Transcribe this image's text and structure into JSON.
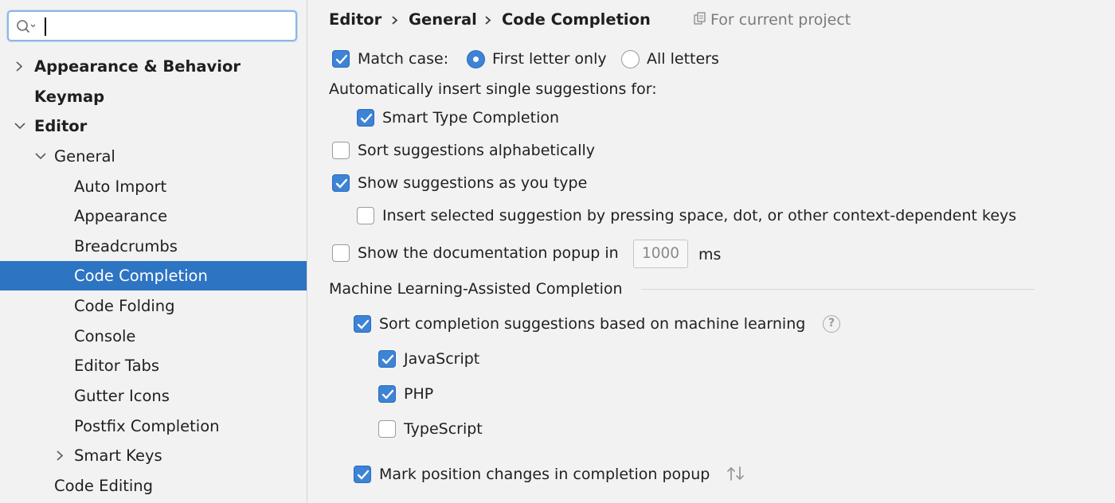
{
  "search": {
    "placeholder": "",
    "value": ""
  },
  "sidebar": {
    "items": [
      {
        "label": "Appearance & Behavior",
        "arrow": "chevron-right"
      },
      {
        "label": "Keymap",
        "arrow": ""
      },
      {
        "label": "Editor",
        "arrow": "chevron-down"
      },
      {
        "label": "General",
        "arrow": "chevron-down"
      },
      {
        "label": "Auto Import",
        "arrow": ""
      },
      {
        "label": "Appearance",
        "arrow": ""
      },
      {
        "label": "Breadcrumbs",
        "arrow": ""
      },
      {
        "label": "Code Completion",
        "arrow": "",
        "selected": true
      },
      {
        "label": "Code Folding",
        "arrow": ""
      },
      {
        "label": "Console",
        "arrow": ""
      },
      {
        "label": "Editor Tabs",
        "arrow": ""
      },
      {
        "label": "Gutter Icons",
        "arrow": ""
      },
      {
        "label": "Postfix Completion",
        "arrow": ""
      },
      {
        "label": "Smart Keys",
        "arrow": "chevron-right"
      },
      {
        "label": "Code Editing",
        "arrow": ""
      }
    ]
  },
  "breadcrumb": {
    "items": [
      "Editor",
      "General",
      "Code Completion"
    ],
    "scope_label": "For current project",
    "scope_icon": "copy-icon"
  },
  "settings": {
    "match_case_label": "Match case:",
    "match_case_checked": true,
    "radio_first_letter_label": "First letter only",
    "radio_all_letters_label": "All letters",
    "radio_selected": "First letter only",
    "auto_insert_heading": "Automatically insert single suggestions for:",
    "smart_type_label": "Smart Type Completion",
    "smart_type_checked": true,
    "sort_alpha_label": "Sort suggestions alphabetically",
    "sort_alpha_checked": false,
    "show_as_type_label": "Show suggestions as you type",
    "show_as_type_checked": true,
    "insert_selected_label": "Insert selected suggestion by pressing space, dot, or other context-dependent keys",
    "insert_selected_checked": false,
    "doc_popup_label": "Show the documentation popup in",
    "doc_popup_checked": false,
    "doc_popup_value": "1000",
    "doc_popup_unit": "ms"
  },
  "ml_section": {
    "title": "Machine Learning-Assisted Completion",
    "sort_ml_label": "Sort completion suggestions based on machine learning",
    "sort_ml_checked": true,
    "help_glyph": "?",
    "languages": [
      {
        "label": "JavaScript",
        "checked": true
      },
      {
        "label": "PHP",
        "checked": true
      },
      {
        "label": "TypeScript",
        "checked": false
      }
    ],
    "mark_position_label": "Mark position changes in completion popup",
    "mark_position_checked": true
  },
  "colors": {
    "accent": "#3d83d6",
    "selection": "#2d74c3",
    "background": "#f2f2f2"
  }
}
